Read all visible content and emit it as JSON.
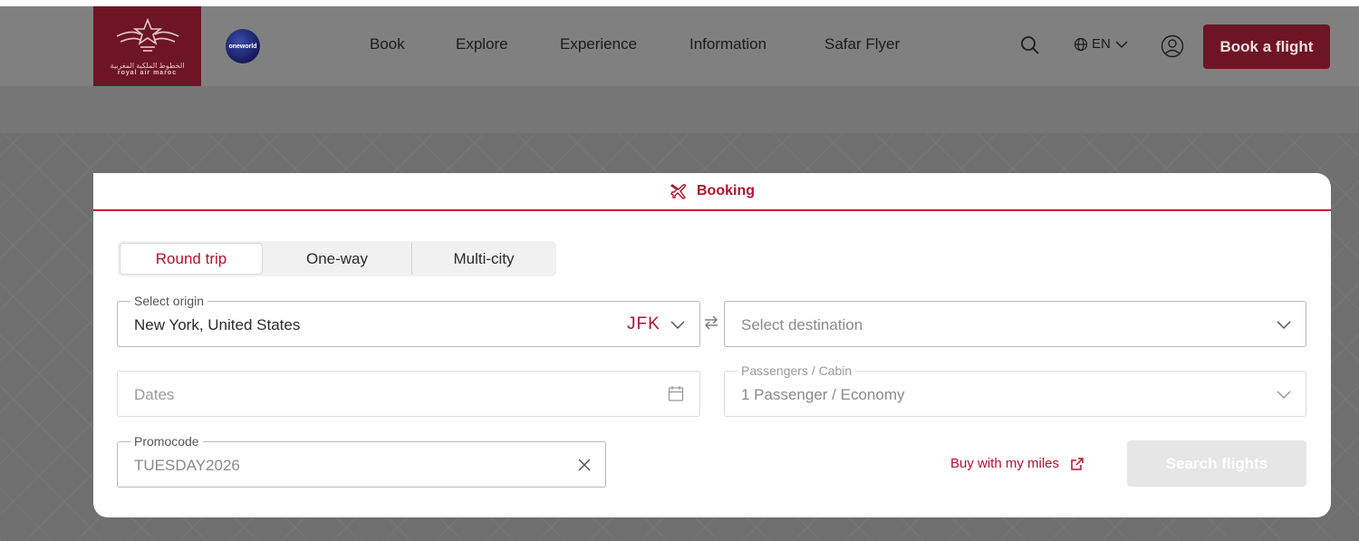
{
  "header": {
    "brand_arabic": "الخطوط الملكية المغربية",
    "brand_latin": "royal air maroc",
    "alliance_label": "oneworld",
    "nav": [
      "Book",
      "Explore",
      "Experience",
      "Information",
      "Safar Flyer"
    ],
    "language": "EN",
    "book_button": "Book a flight",
    "icons": [
      "search-icon",
      "globe-icon",
      "chevron-down-icon",
      "user-icon"
    ]
  },
  "booking": {
    "tab_label": "Booking",
    "trip_types": [
      "Round trip",
      "One-way",
      "Multi-city"
    ],
    "selected_trip_type": "Round trip",
    "origin": {
      "label": "Select origin",
      "value": "New York, United States",
      "code": "JFK"
    },
    "destination": {
      "placeholder": "Select destination"
    },
    "dates": {
      "placeholder": "Dates"
    },
    "passengers": {
      "label": "Passengers / Cabin",
      "value": "1 Passenger / Economy"
    },
    "promocode": {
      "label": "Promocode",
      "value": "TUESDAY2026"
    },
    "buy_with_miles": "Buy with my miles",
    "search_button": "Search flights"
  },
  "colors": {
    "brand": "#6e1525",
    "accent": "#b0122f",
    "disabled_button": "#e6e6e6"
  }
}
